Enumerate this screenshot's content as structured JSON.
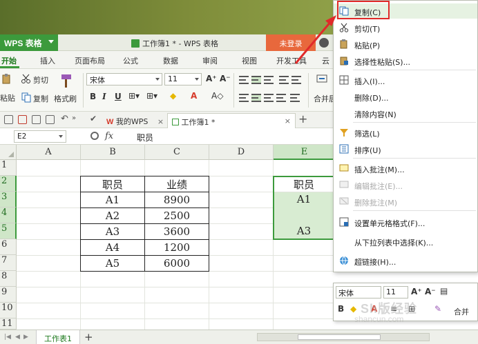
{
  "titlebar": {
    "app_name": "WPS 表格",
    "doc_title": "工作簿1 * - WPS 表格",
    "login": "未登录"
  },
  "tabs": [
    "开始",
    "插入",
    "页面布局",
    "公式",
    "数据",
    "审阅",
    "视图",
    "开发工具",
    "云"
  ],
  "ribbon": {
    "cut": "剪切",
    "copy": "复制",
    "format_painter": "格式刷",
    "paste": "粘贴",
    "font": "宋体",
    "font_size": "11",
    "merge": "合并居"
  },
  "quick_access": {
    "doc_tab_wps": "我的WPS",
    "doc_tab_book": "工作簿1 *"
  },
  "formula_bar": {
    "cell_ref": "E2",
    "fx": "fx",
    "content": "职员"
  },
  "columns": [
    "A",
    "B",
    "C",
    "D",
    "E"
  ],
  "rows": [
    "1",
    "2",
    "3",
    "4",
    "5",
    "6",
    "7",
    "8",
    "9",
    "10",
    "11"
  ],
  "table": {
    "header": [
      "职员",
      "业绩"
    ],
    "rows": [
      [
        "A1",
        "8900"
      ],
      [
        "A2",
        "2500"
      ],
      [
        "A3",
        "3600"
      ],
      [
        "A4",
        "1200"
      ],
      [
        "A5",
        "6000"
      ]
    ]
  },
  "column_e": [
    "职员",
    "A1",
    "",
    "A3"
  ],
  "context_menu": [
    "复制(C)",
    "剪切(T)",
    "粘贴(P)",
    "选择性粘贴(S)...",
    "插入(I)...",
    "删除(D)...",
    "清除内容(N)",
    "筛选(L)",
    "排序(U)",
    "插入批注(M)...",
    "编辑批注(E)...",
    "删除批注(M)",
    "设置单元格格式(F)...",
    "从下拉列表中选择(K)...",
    "超链接(H)..."
  ],
  "mini_toolbar": {
    "font": "宋体",
    "size": "11",
    "merge": "合并"
  },
  "sheet_tab": "工作表1",
  "watermark": {
    "line1": "Sh版经验",
    "line2": "shancun.com"
  },
  "colors": {
    "accent": "#3c9a3c",
    "login": "#e8683c",
    "highlight_box": "#e02a2a"
  }
}
